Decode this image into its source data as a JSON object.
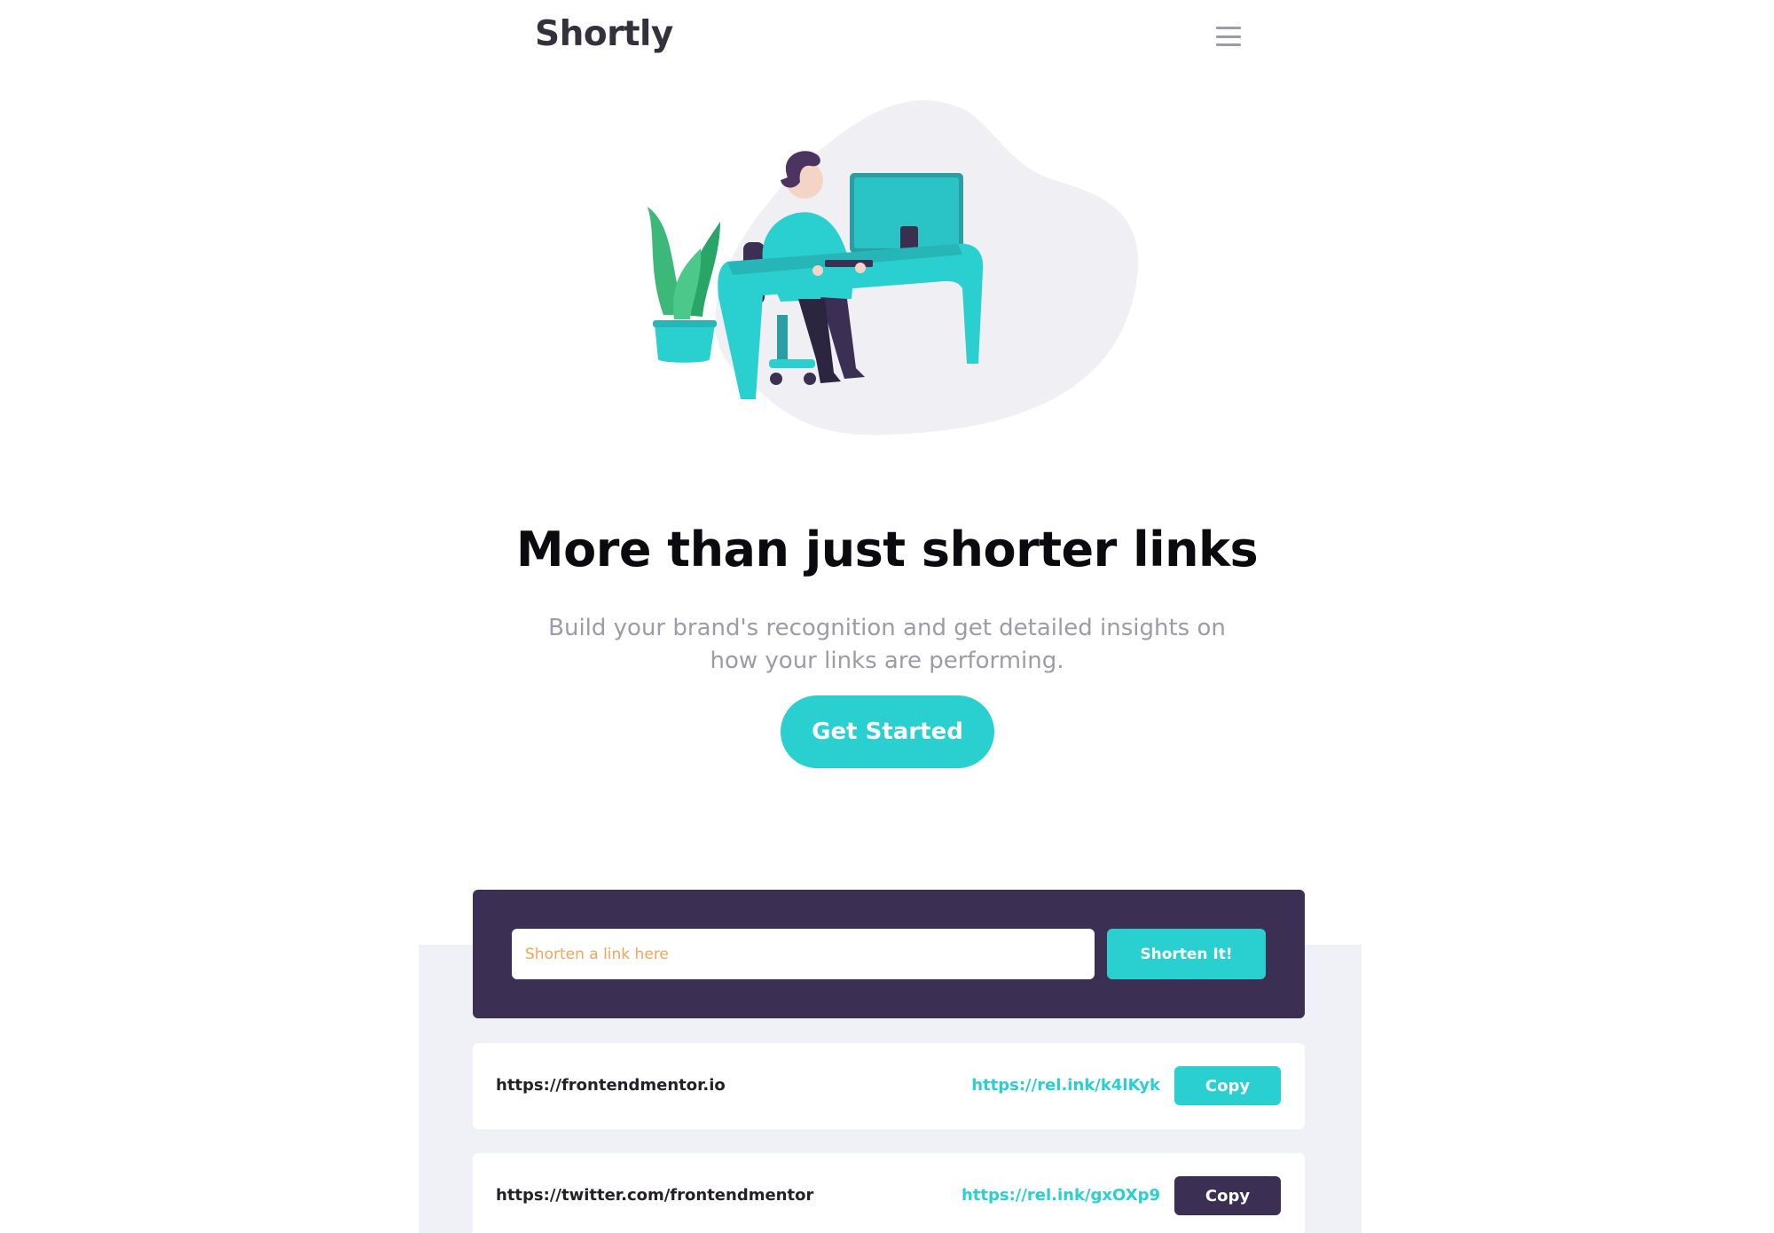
{
  "header": {
    "logo": "Shortly",
    "menu_icon": "hamburger-menu-icon"
  },
  "hero": {
    "illustration": "person-working-at-desk-illustration",
    "title": "More than just shorter links",
    "subtitle": "Build your brand's recognition and get detailed insights on how your links are performing.",
    "cta_label": "Get Started"
  },
  "shorten": {
    "placeholder": "Shorten a link here",
    "value": "",
    "button_label": "Shorten It!"
  },
  "results": [
    {
      "original": "https://frontendmentor.io",
      "short": "https://rel.ink/k4lKyk",
      "copy_label": "Copy",
      "copy_state": "default"
    },
    {
      "original": "https://twitter.com/frontendmentor",
      "short": "https://rel.ink/gxOXp9",
      "copy_label": "Copy",
      "copy_state": "copied-dark"
    }
  ],
  "colors": {
    "cyan": "#2acfcf",
    "dark_violet": "#3b3054",
    "gray": "#9e9aa7",
    "very_dark_blue": "#34313d",
    "placeholder_orange": "#f4a45b",
    "stats_bg": "#f0f1f6"
  }
}
